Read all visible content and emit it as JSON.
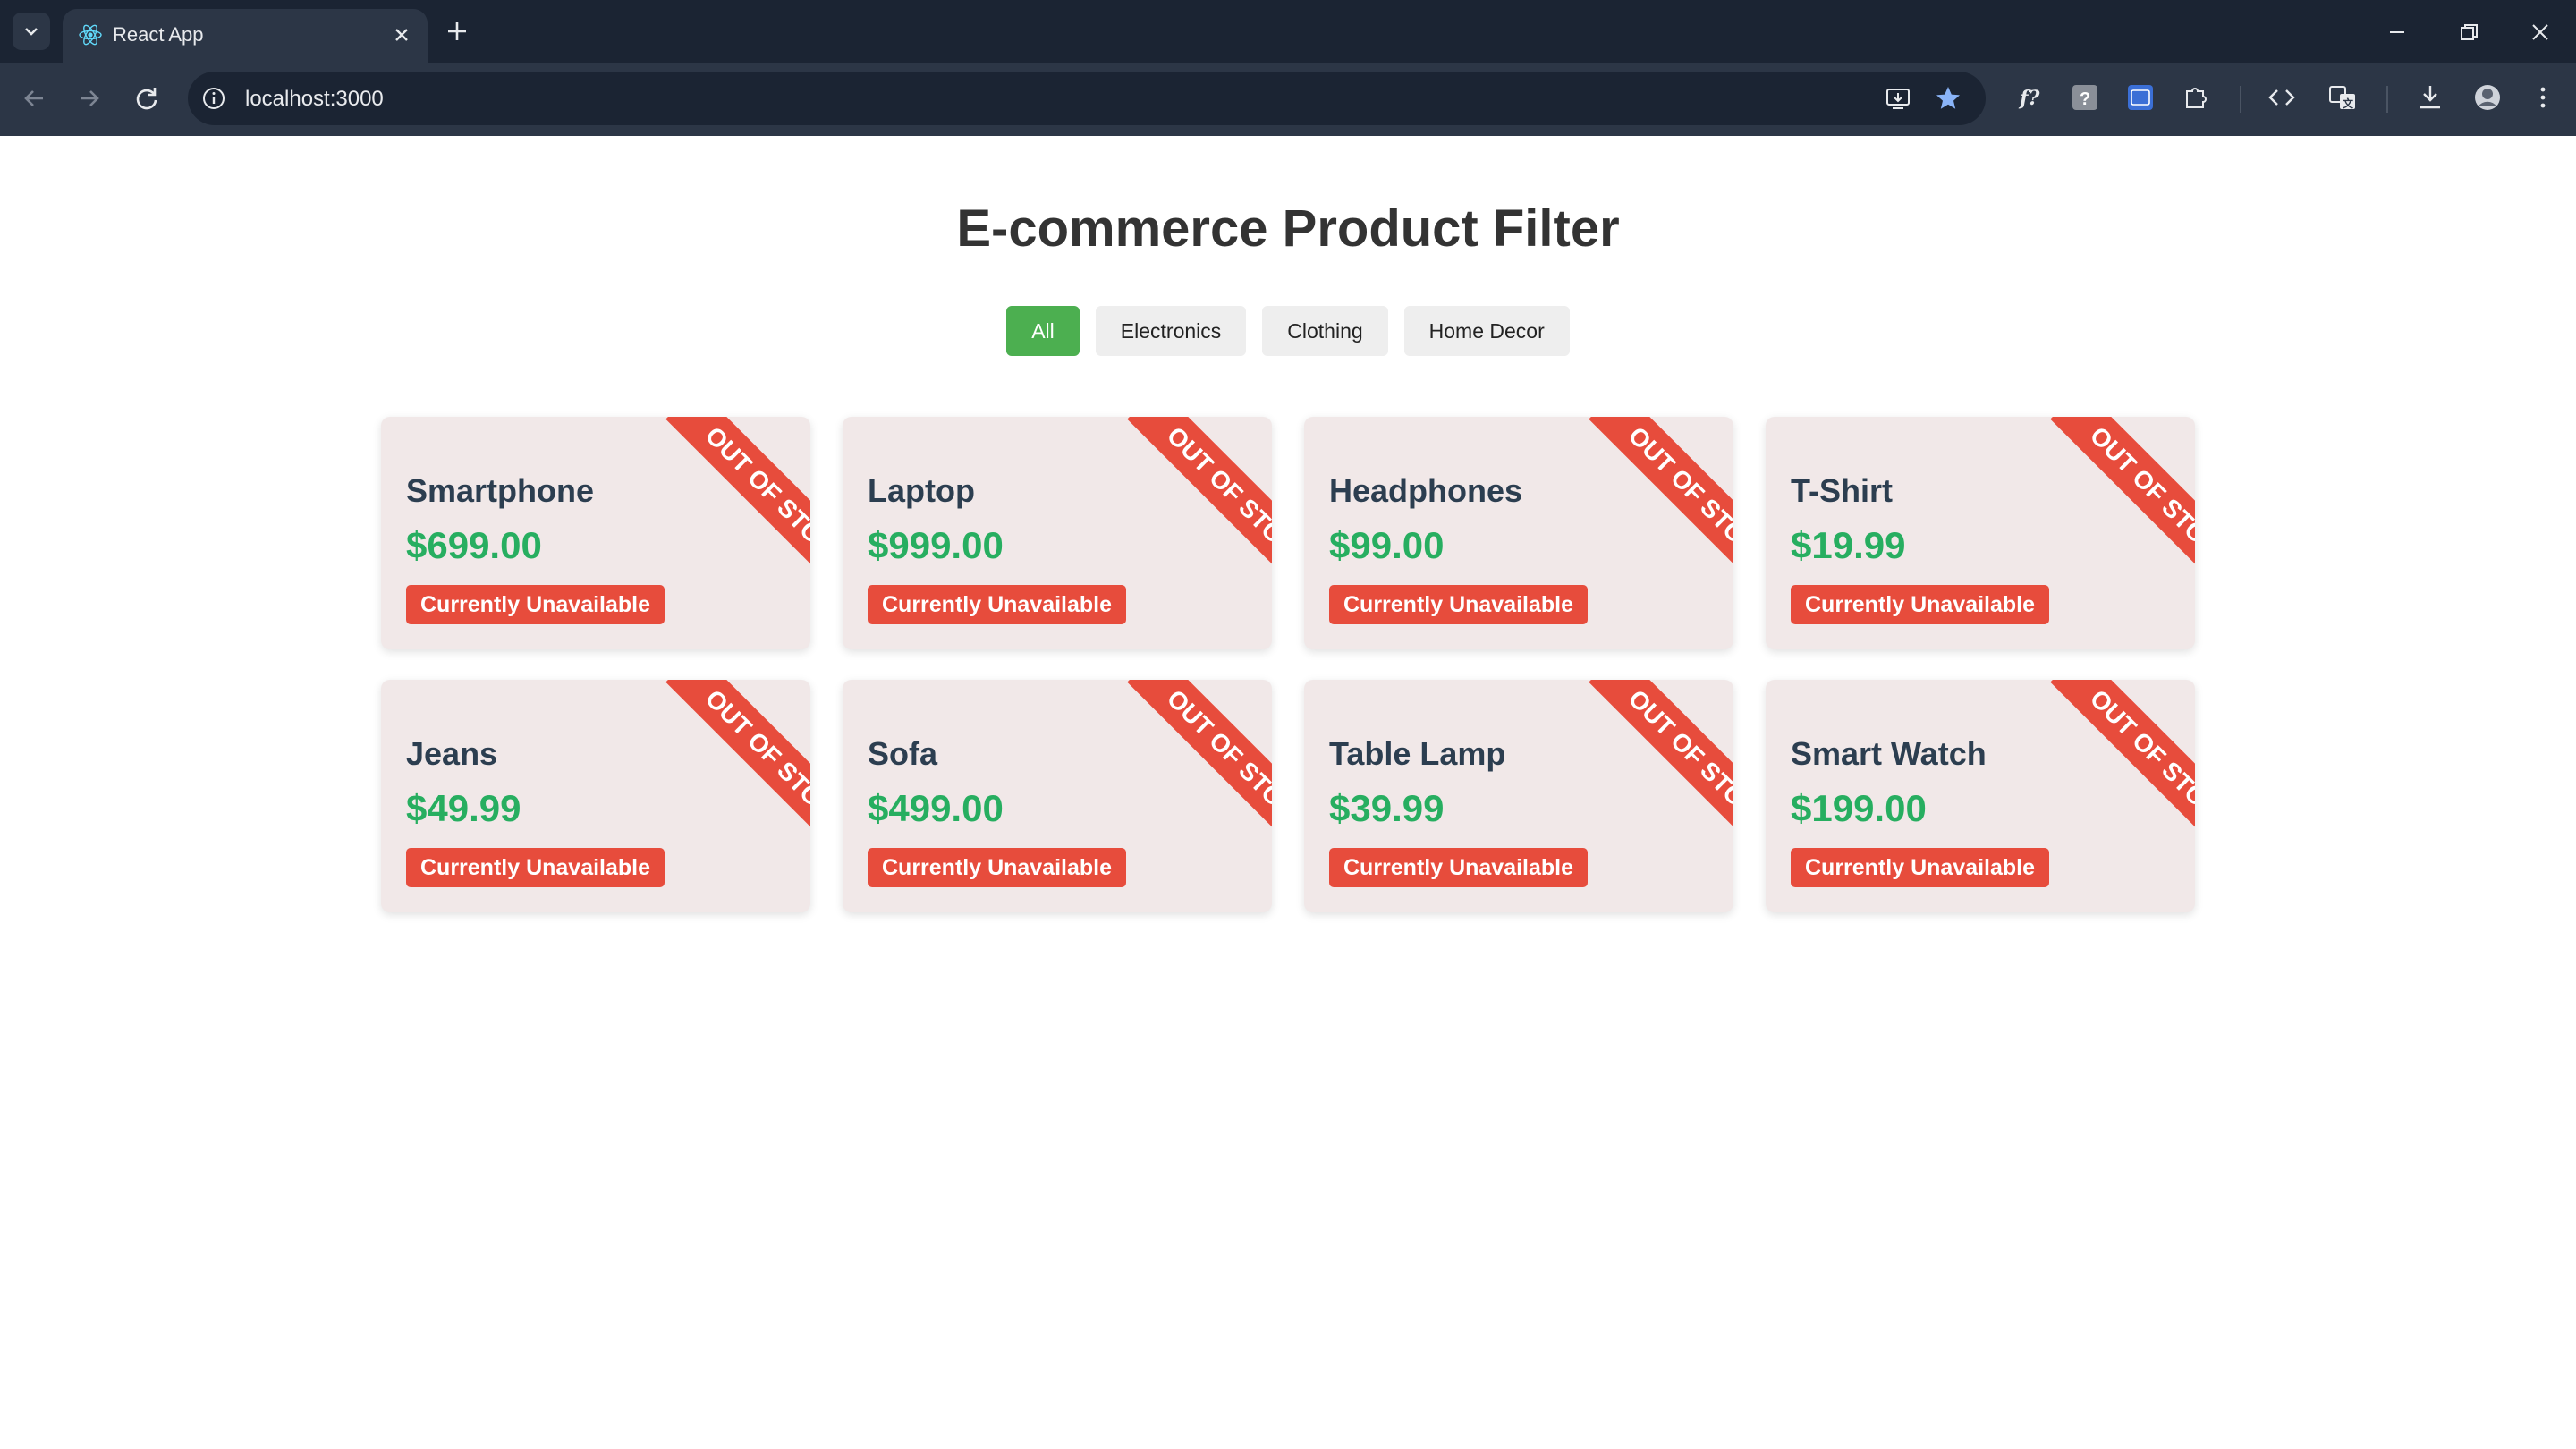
{
  "browser": {
    "tab_title": "React App",
    "url": "localhost:3000"
  },
  "page": {
    "title": "E-commerce Product Filter",
    "filters": [
      {
        "label": "All",
        "active": true
      },
      {
        "label": "Electronics",
        "active": false
      },
      {
        "label": "Clothing",
        "active": false
      },
      {
        "label": "Home Decor",
        "active": false
      }
    ],
    "ribbon_text": "OUT OF STOCK",
    "products": [
      {
        "name": "Smartphone",
        "price": "$699.00",
        "status": "Currently Unavailable"
      },
      {
        "name": "Laptop",
        "price": "$999.00",
        "status": "Currently Unavailable"
      },
      {
        "name": "Headphones",
        "price": "$99.00",
        "status": "Currently Unavailable"
      },
      {
        "name": "T-Shirt",
        "price": "$19.99",
        "status": "Currently Unavailable"
      },
      {
        "name": "Jeans",
        "price": "$49.99",
        "status": "Currently Unavailable"
      },
      {
        "name": "Sofa",
        "price": "$499.00",
        "status": "Currently Unavailable"
      },
      {
        "name": "Table Lamp",
        "price": "$39.99",
        "status": "Currently Unavailable"
      },
      {
        "name": "Smart Watch",
        "price": "$199.00",
        "status": "Currently Unavailable"
      }
    ]
  },
  "colors": {
    "active_filter": "#4caf50",
    "price": "#27ae60",
    "out_of_stock": "#e74c3c",
    "card_bg": "#f1e8e8"
  }
}
